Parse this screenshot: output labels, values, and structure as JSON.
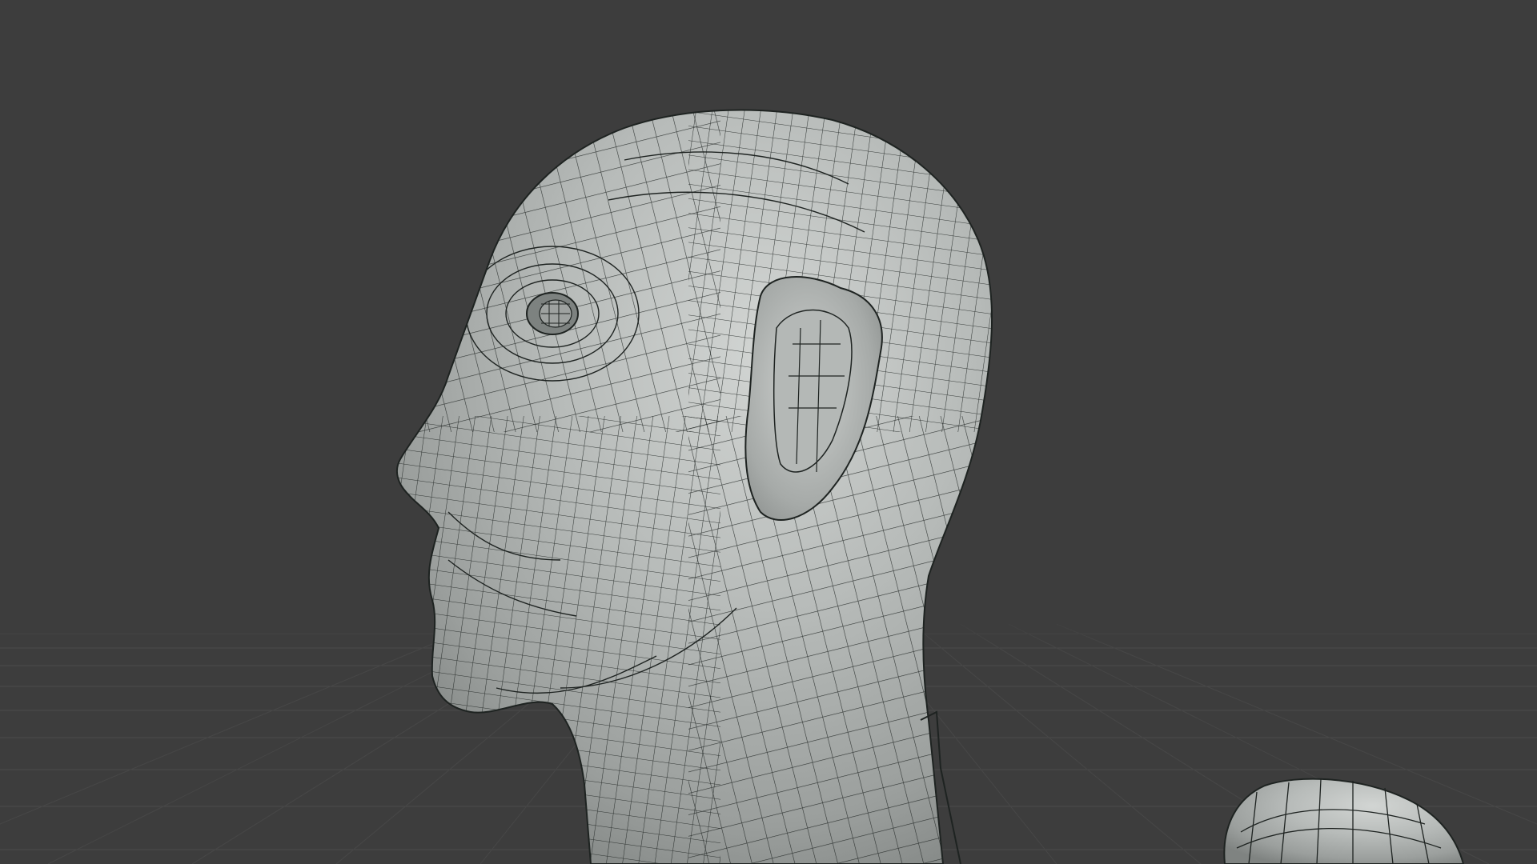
{
  "viewport": {
    "label": "3D viewport",
    "background_color": "#3d3d3d",
    "grid_color": "#4a4a4a",
    "grid_visible": true,
    "shading": "solid",
    "wireframe_overlay": true
  },
  "objects": [
    {
      "name": "head-mesh",
      "kind": "quad topology head and neck",
      "base_color": "#a9adab",
      "wire_color": "#1e2321"
    },
    {
      "name": "secondary-mesh-partial",
      "kind": "partial mesh object",
      "base_color": "#a9adab",
      "wire_color": "#1e2321"
    }
  ]
}
